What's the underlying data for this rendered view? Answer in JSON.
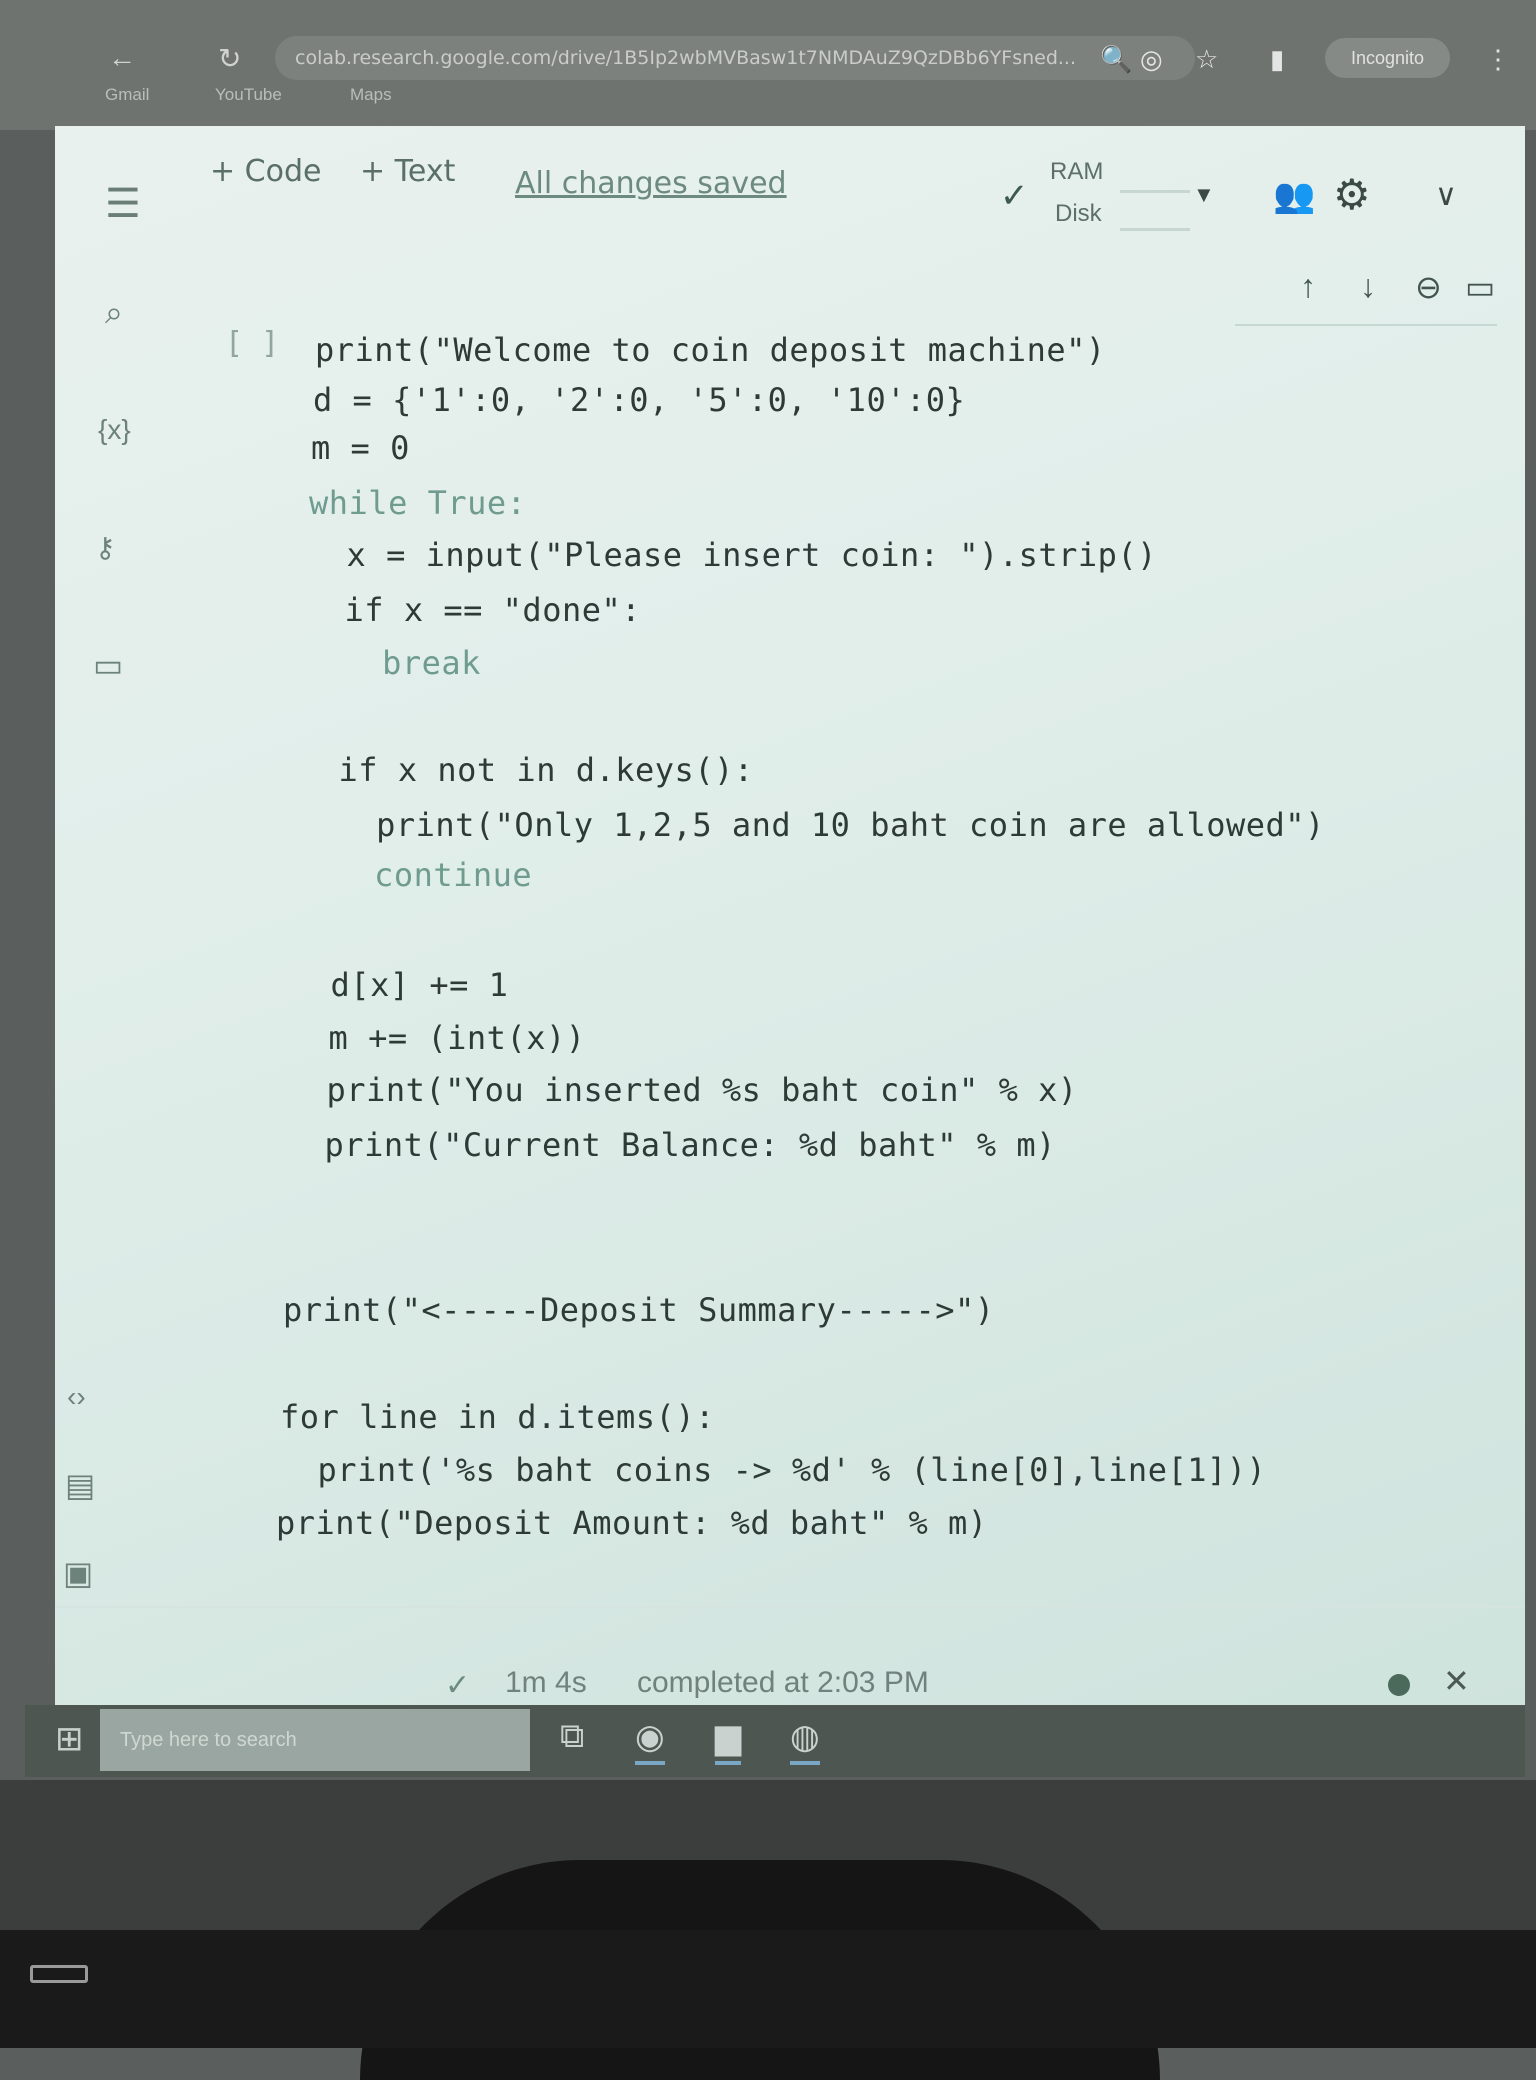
{
  "browser": {
    "url": "colab.research.google.com/drive/1B5Ip2wbMVBasw1t7NMDAuZ9QzDBb6YFsned...",
    "profile": "Incognito",
    "bookmarks": [
      "Gmail",
      "YouTube",
      "Maps"
    ]
  },
  "toolbar": {
    "add_code": "+ Code",
    "add_text": "+ Text",
    "saved_status": "All changes saved",
    "ram_label": "RAM",
    "disk_label": "Disk"
  },
  "cell": {
    "run_brackets": "[ ]",
    "code_lines": [
      "print(\"Welcome to coin deposit machine\")",
      "d = {'1':0, '2':0, '5':0, '10':0}",
      "m = 0",
      "while True:",
      "  x = input(\"Please insert coin: \").strip()",
      "  if x == \"done\":",
      "    break",
      "",
      "  if x not in d.keys():",
      "    print(\"Only 1,2,5 and 10 baht coin are allowed\")",
      "    continue",
      "",
      "  d[x] += 1",
      "  m += (int(x))",
      "  print(\"You inserted %s baht coin\" % x)",
      "  print(\"Current Balance: %d baht\" % m)",
      "",
      "",
      "print(\"<-----Deposit Summary----->\")",
      "",
      "for line in d.items():",
      "  print('%s baht coins -> %d' % (line[0],line[1]))",
      "print(\"Deposit Amount: %d baht\" % m)"
    ]
  },
  "status": {
    "duration": "1m 4s",
    "message": "completed at 2:03 PM"
  },
  "taskbar": {
    "search_placeholder": "Type here to search"
  }
}
